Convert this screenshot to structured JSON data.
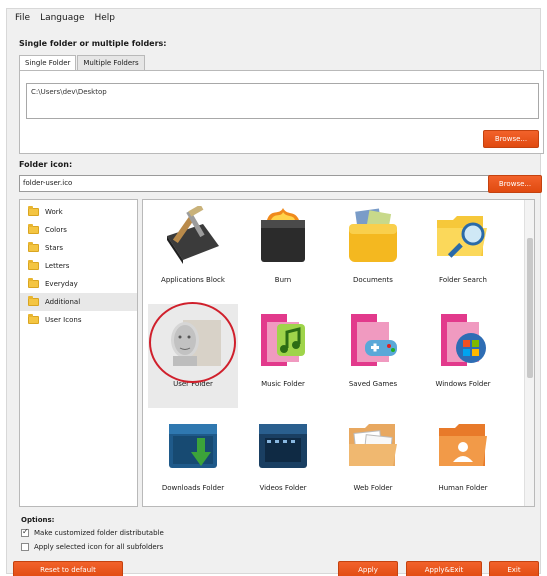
{
  "menu": [
    "File",
    "Language",
    "Help"
  ],
  "folder_section": {
    "label": "Single folder or multiple folders:",
    "tabs": [
      "Single Folder",
      "Multiple Folders"
    ],
    "path_value": "C:\\Users\\dev\\Desktop",
    "browse_label": "Browse..."
  },
  "icon_section": {
    "label": "Folder icon:",
    "icon_value": "folder-user.ico",
    "browse_label": "Browse..."
  },
  "categories": [
    "Work",
    "Colors",
    "Stars",
    "Letters",
    "Everyday",
    "Additional",
    "User Icons"
  ],
  "selected_category": "Additional",
  "icons": [
    {
      "label": "Applications Block",
      "icon": "tools-folder-icon"
    },
    {
      "label": "Burn",
      "icon": "burn-folder-icon"
    },
    {
      "label": "Documents",
      "icon": "documents-folder-icon"
    },
    {
      "label": "Folder Search",
      "icon": "folder-search-icon"
    },
    {
      "label": "User Folder",
      "icon": "user-folder-icon"
    },
    {
      "label": "Music Folder",
      "icon": "music-folder-icon"
    },
    {
      "label": "Saved Games",
      "icon": "saved-games-folder-icon"
    },
    {
      "label": "Windows Folder",
      "icon": "windows-folder-icon"
    },
    {
      "label": "Downloads Folder",
      "icon": "downloads-folder-icon"
    },
    {
      "label": "Videos Folder",
      "icon": "videos-folder-icon"
    },
    {
      "label": "Web Folder",
      "icon": "web-folder-icon"
    },
    {
      "label": "Human Folder",
      "icon": "human-folder-icon"
    }
  ],
  "options": {
    "label": "Options:",
    "items": [
      {
        "label": "Make customized folder distributable",
        "checked": true
      },
      {
        "label": "Apply selected icon for all subfolders",
        "checked": false
      }
    ]
  },
  "buttons": {
    "reset": "Reset to default",
    "apply": "Apply",
    "apply_exit": "Apply&Exit",
    "exit": "Exit"
  },
  "colors": {
    "accent": "#e8561c",
    "highlight_ring": "#d0202c"
  }
}
